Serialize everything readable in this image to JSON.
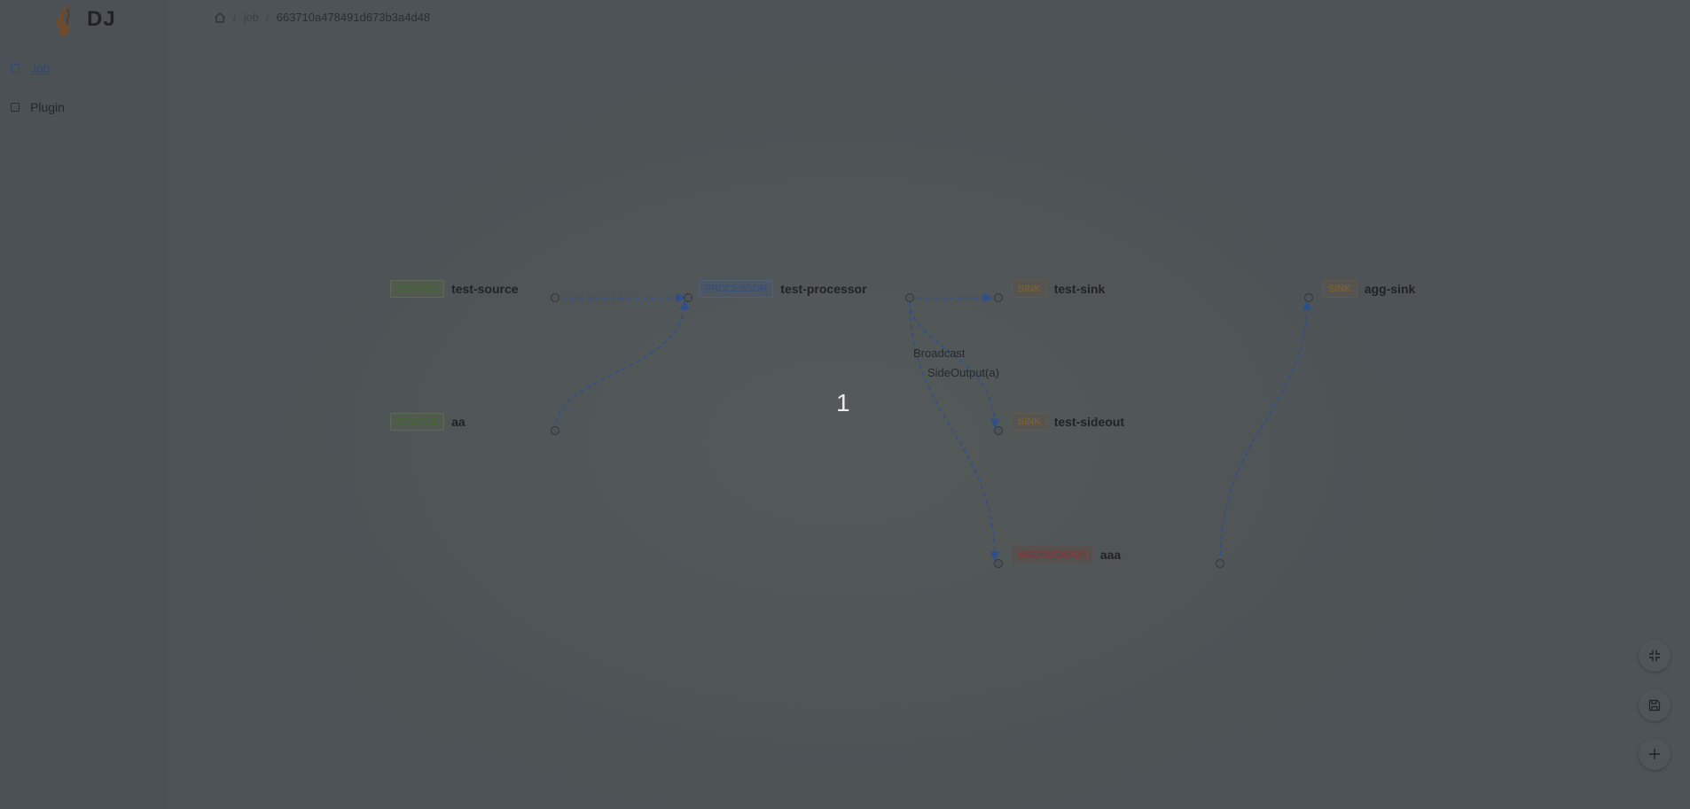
{
  "app": {
    "logo_text": "DJ"
  },
  "sidebar": {
    "items": [
      {
        "label": "Job",
        "active": true
      },
      {
        "label": "Plugin",
        "active": false
      }
    ]
  },
  "breadcrumb": {
    "items": [
      "job",
      "663710a478491d673b3a4d48"
    ]
  },
  "graph": {
    "nodes": [
      {
        "type": "SOURCE",
        "name": "test-source"
      },
      {
        "type": "SOURCE",
        "name": "aa"
      },
      {
        "type": "PROCESSOR",
        "name": "test-processor"
      },
      {
        "type": "SINK",
        "name": "test-sink"
      },
      {
        "type": "SINK",
        "name": "test-sideout"
      },
      {
        "type": "AGGREGATOR",
        "name": "aaa"
      },
      {
        "type": "SINK",
        "name": "agg-sink"
      }
    ],
    "edge_labels": [
      "Broadcast",
      "SideOutput(a)"
    ],
    "counter": "1"
  },
  "toolbar": {
    "icons": [
      "compress-icon",
      "save-icon",
      "plus-icon"
    ]
  },
  "colors": {
    "overlay_bg": "#4d5356",
    "edge": "#2f4e8c",
    "source": "#3f6a30",
    "processor": "#2d4f83",
    "sink": "#8a6420",
    "aggregator": "#8b2f2f"
  }
}
